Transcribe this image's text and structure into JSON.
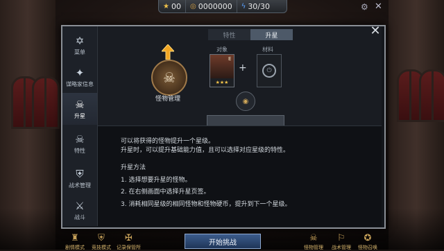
{
  "status_bar": {
    "stars": "00",
    "gold": "0000000",
    "energy": "30/30"
  },
  "dialog": {
    "tabs": [
      {
        "label": "特性"
      },
      {
        "label": "升星"
      }
    ],
    "emblem_label": "怪物管理",
    "target_label": "对象",
    "material_label": "材料",
    "target_stars": "★★★",
    "target_grade": "E",
    "plus": "+"
  },
  "sidebar": {
    "items": [
      {
        "label": "菜单",
        "icon": "star-of-david-icon"
      },
      {
        "label": "谋略家信息",
        "icon": "star-lightning-icon"
      },
      {
        "label": "升星",
        "icon": "skull-icon"
      },
      {
        "label": "特性",
        "icon": "skull-icon"
      },
      {
        "label": "战术管理",
        "icon": "shield-icon"
      },
      {
        "label": "战斗",
        "icon": "sword-shield-icon"
      }
    ]
  },
  "info": {
    "line1": "可以将获得的怪物提升一个星级。",
    "line2": "升星时，可以提升基础能力值，且可以选择对应星级的特性。",
    "method_title": "升星方法",
    "step1": "1. 选择想要升星的怪物。",
    "step2": "2. 在右侧画面中选择升星页签。",
    "step3": "3. 消耗相同星级的相同怪物和怪物硬币，提升到下一个星级。"
  },
  "bottom_bar": {
    "left_buttons": [
      {
        "label": "剧情模式",
        "icon": "story-icon"
      },
      {
        "label": "竞技模式",
        "icon": "arena-icon"
      },
      {
        "label": "记录保管所",
        "icon": "record-icon"
      }
    ],
    "start_label": "开始挑战",
    "right_buttons": [
      {
        "label": "怪物管理",
        "icon": "monster-icon"
      },
      {
        "label": "战术管理",
        "icon": "tactics-icon"
      },
      {
        "label": "怪物召唤",
        "icon": "summon-icon"
      }
    ]
  },
  "colors": {
    "accent_gold": "#d7b56d",
    "star_yellow": "#f0c24a",
    "energy_blue": "#5aa0ff"
  }
}
